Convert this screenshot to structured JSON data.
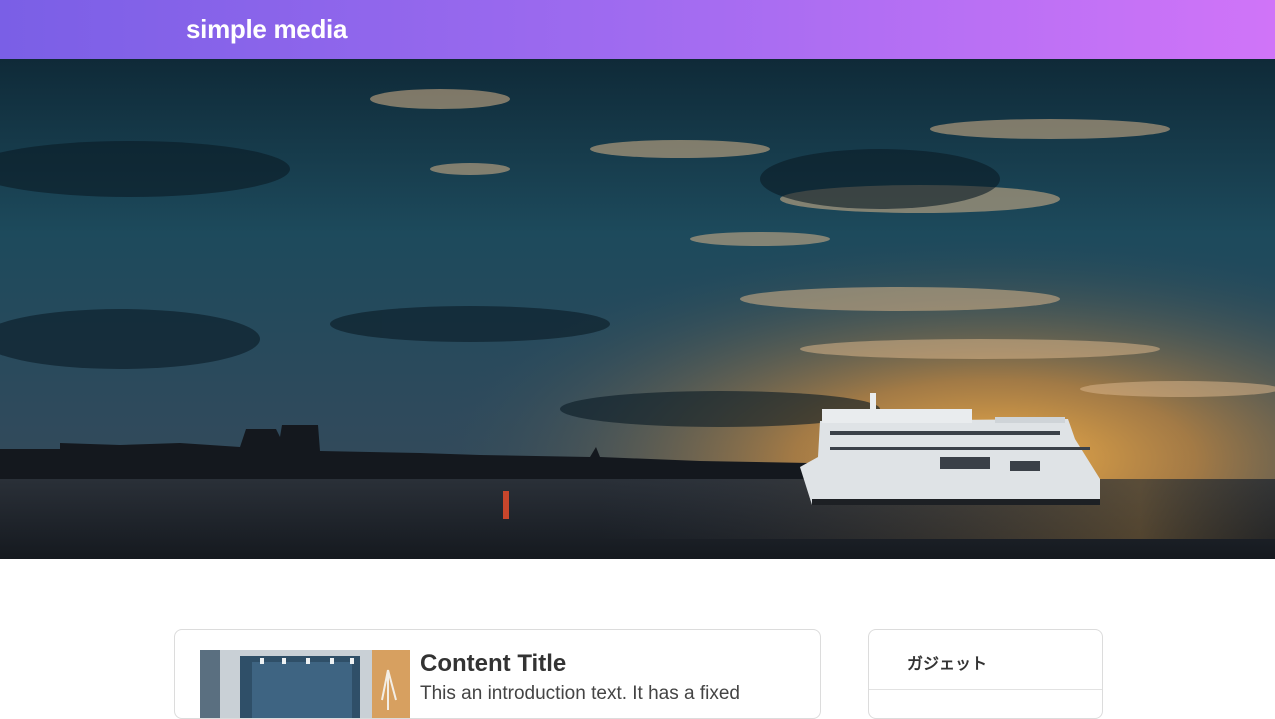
{
  "header": {
    "logo_text": "simple media",
    "gradient_start": "#7a5fe6",
    "gradient_end": "#d074f8"
  },
  "hero": {
    "image": "harbor-sunset-ferry-photo"
  },
  "main": {
    "card": {
      "title": "Content Title",
      "intro": "This an introduction text. It has a fixed",
      "thumbnail": "interior-room-photo"
    }
  },
  "sidebar": {
    "widget_title": "ガジェット"
  }
}
